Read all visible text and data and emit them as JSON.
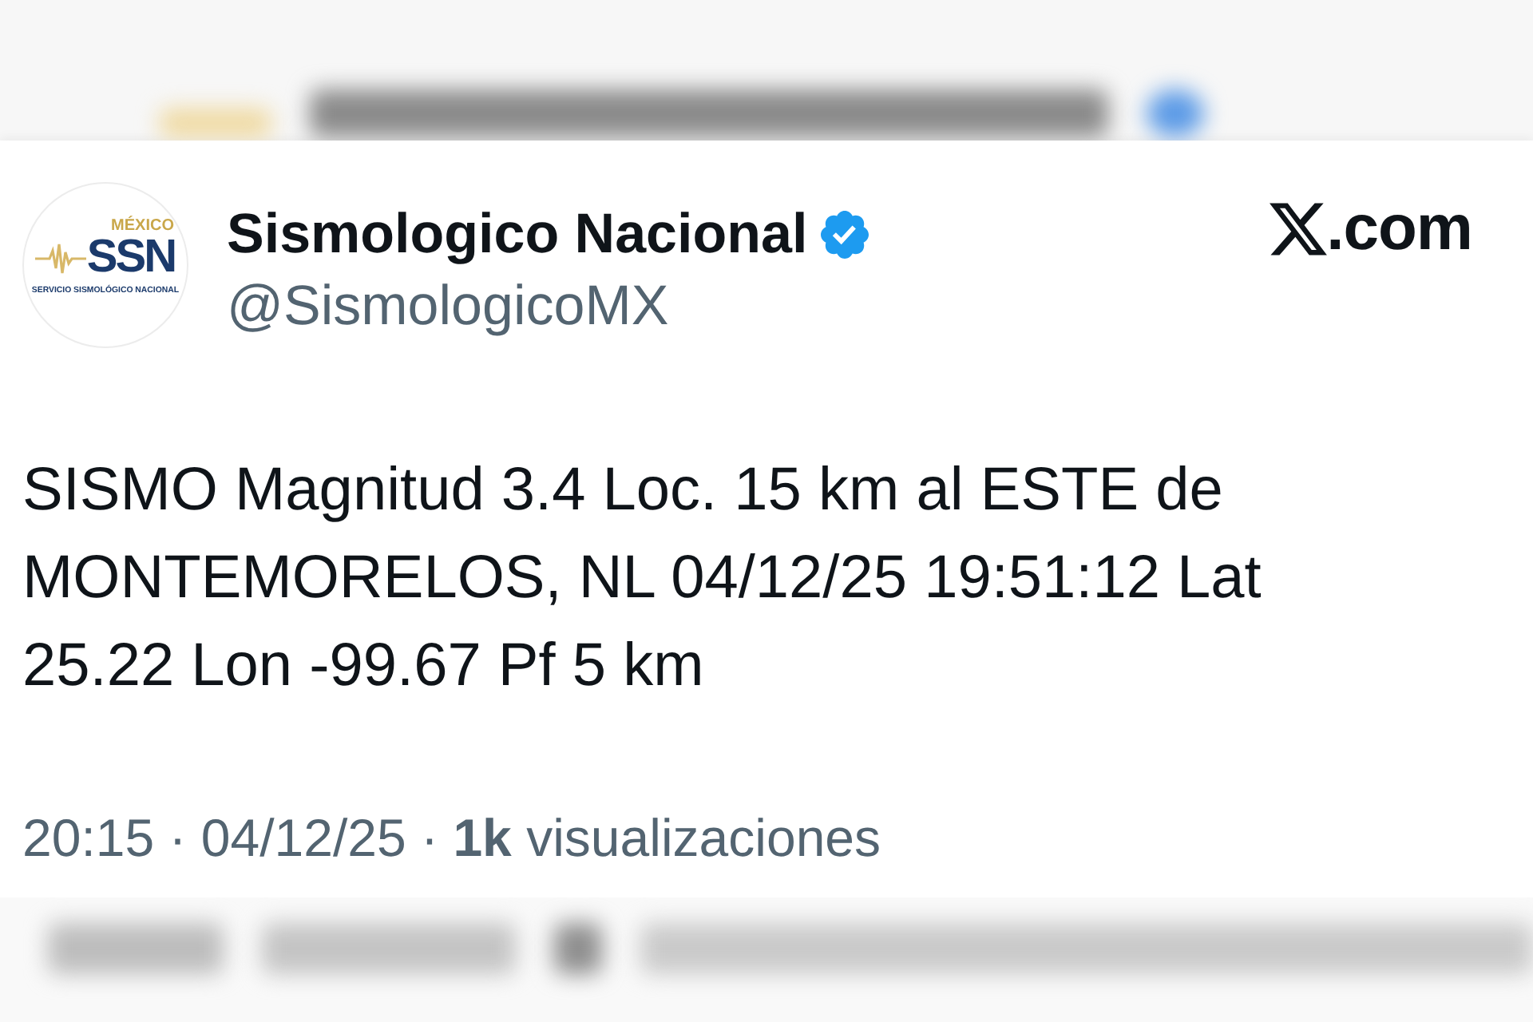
{
  "account": {
    "avatar": {
      "country": "MÉXICO",
      "acronym": "SSN",
      "caption": "SERVICIO SISMOLÓGICO NACIONAL"
    },
    "name": "Sismologico Nacional",
    "verified": true,
    "handle": "@SismologicoMX"
  },
  "site": {
    "label": ".com"
  },
  "post": {
    "text": "SISMO Magnitud 3.4 Loc. 15 km al ESTE de MONTEMORELOS, NL 04/12/25 19:51:12 Lat 25.22 Lon -99.67 Pf 5 km",
    "meta": "20:15 · 04/12/25 · **1k** visualizaciones"
  }
}
